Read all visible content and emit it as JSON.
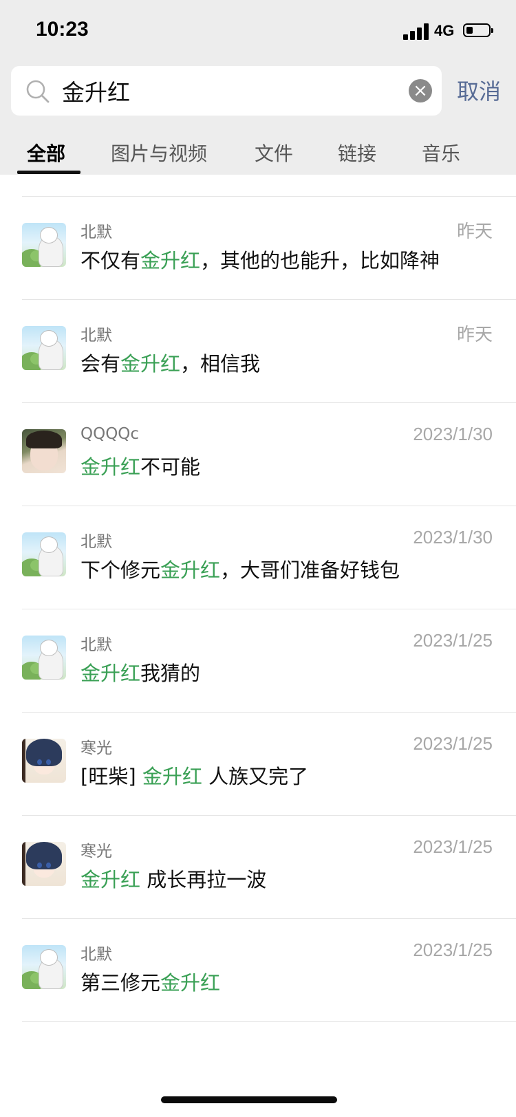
{
  "status_bar": {
    "time": "10:23",
    "network": "4G",
    "battery_level": 0.3
  },
  "search": {
    "query": "金升红",
    "placeholder": "搜索",
    "cancel_label": "取消"
  },
  "tabs": [
    {
      "label": "全部",
      "active": true
    },
    {
      "label": "图片与视频",
      "active": false
    },
    {
      "label": "文件",
      "active": false
    },
    {
      "label": "链接",
      "active": false
    },
    {
      "label": "音乐",
      "active": false
    }
  ],
  "results": [
    {
      "avatar": "cartoon-avatar",
      "sender": "北默",
      "date": "昨天",
      "before": "不仅有",
      "keyword": "金升红",
      "after": "，其他的也能升，比如降神"
    },
    {
      "avatar": "cartoon-avatar",
      "sender": "北默",
      "date": "昨天",
      "before": "会有",
      "keyword": "金升红",
      "after": "，相信我"
    },
    {
      "avatar": "photo-avatar",
      "sender": "QQQQc",
      "date": "2023/1/30",
      "before": "",
      "keyword": "金升红",
      "after": "不可能"
    },
    {
      "avatar": "cartoon-avatar",
      "sender": "北默",
      "date": "2023/1/30",
      "before": "下个修元",
      "keyword": "金升红",
      "after": "，大哥们准备好钱包"
    },
    {
      "avatar": "cartoon-avatar",
      "sender": "北默",
      "date": "2023/1/25",
      "before": "",
      "keyword": "金升红",
      "after": "我猜的"
    },
    {
      "avatar": "anime-avatar",
      "sender": "寒光",
      "date": "2023/1/25",
      "before": "[旺柴] ",
      "keyword": "金升红",
      "after": " 人族又完了"
    },
    {
      "avatar": "anime-avatar",
      "sender": "寒光",
      "date": "2023/1/25",
      "before": "",
      "keyword": "金升红",
      "after": " 成长再拉一波"
    },
    {
      "avatar": "cartoon-avatar",
      "sender": "北默",
      "date": "2023/1/25",
      "before": "第三修元",
      "keyword": "金升红",
      "after": ""
    }
  ],
  "colors": {
    "highlight": "#3aa055",
    "cancel": "#576b95",
    "header_bg": "#ededed"
  }
}
